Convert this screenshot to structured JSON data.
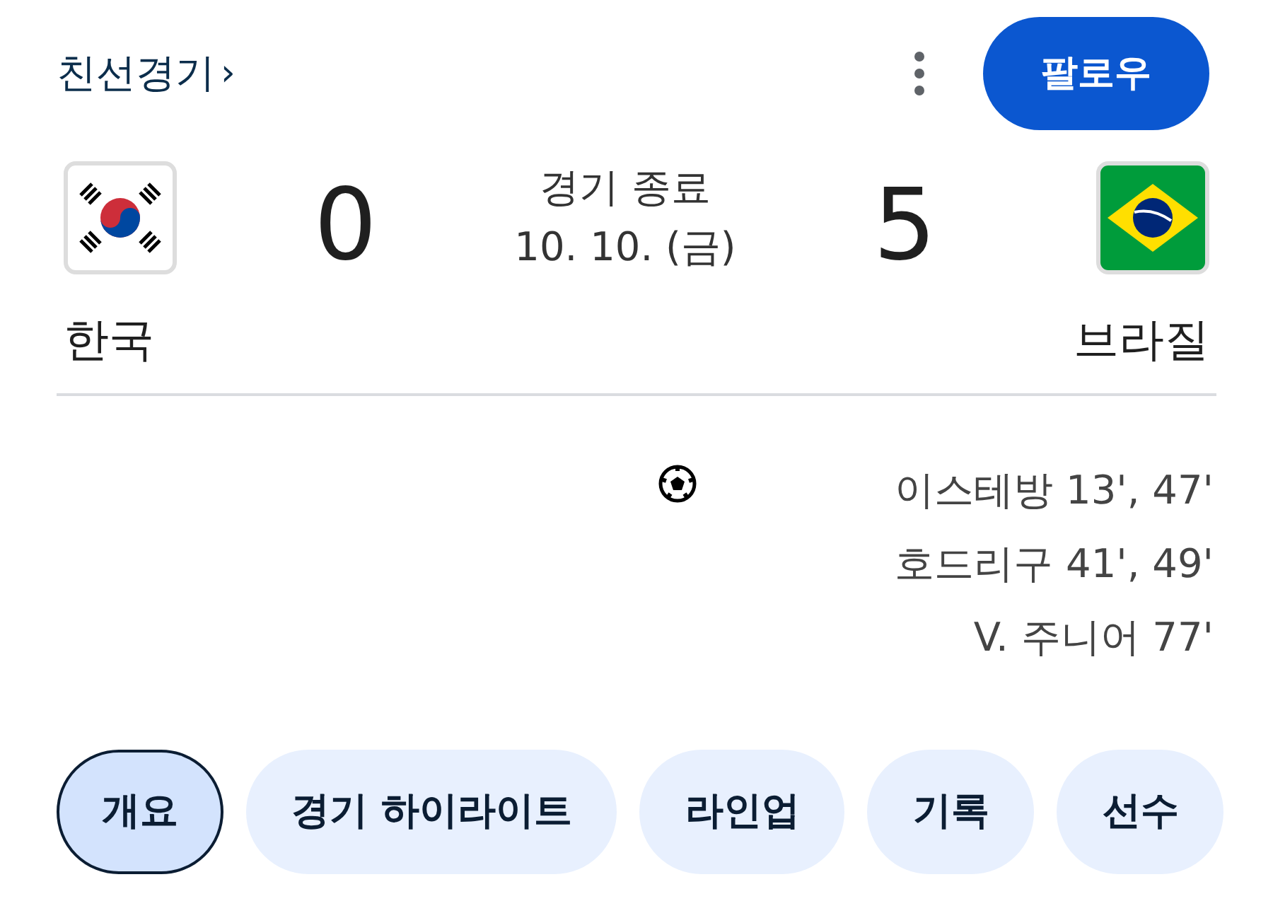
{
  "header": {
    "title": "친선경기",
    "chevron": "›",
    "follow_button": "팔로우"
  },
  "match": {
    "status": "경기 종료",
    "date": "10. 10. (금)",
    "home": {
      "name": "한국",
      "score": "0",
      "kind": "korea"
    },
    "away": {
      "name": "브라질",
      "score": "5",
      "kind": "brazil"
    }
  },
  "goals": {
    "away": [
      "이스테방 13', 47'",
      "호드리구 41', 49'",
      "V. 주니어 77'"
    ]
  },
  "tabs": [
    {
      "label": "개요",
      "selected": true
    },
    {
      "label": "경기 하이라이트",
      "selected": false
    },
    {
      "label": "라인업",
      "selected": false
    },
    {
      "label": "기록",
      "selected": false
    },
    {
      "label": "선수",
      "selected": false
    }
  ]
}
